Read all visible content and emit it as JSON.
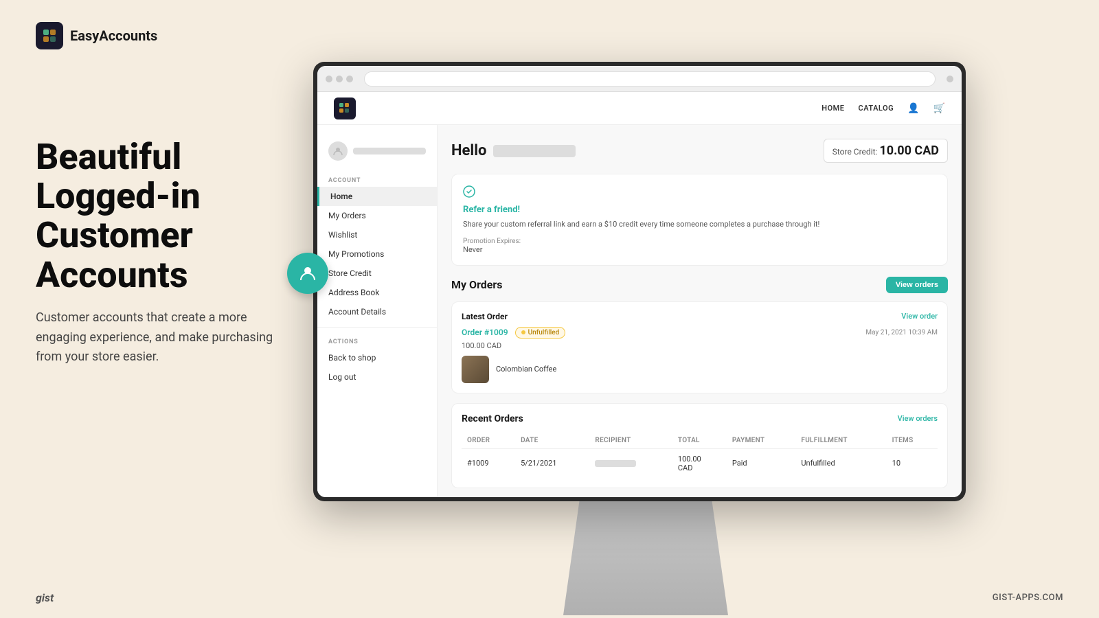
{
  "brand": {
    "name": "EasyAccounts",
    "logo_alt": "EasyAccounts logo"
  },
  "hero": {
    "title": "Beautiful Logged-in Customer Accounts",
    "subtitle": "Customer accounts that create a more engaging experience, and make purchasing from your store easier."
  },
  "store": {
    "nav": {
      "home": "HOME",
      "catalog": "CATALOG"
    },
    "sidebar": {
      "section_account": "ACCOUNT",
      "section_actions": "ACTIONS",
      "items": [
        {
          "label": "Home",
          "active": true
        },
        {
          "label": "My Orders",
          "active": false
        },
        {
          "label": "Wishlist",
          "active": false
        },
        {
          "label": "My Promotions",
          "active": false
        },
        {
          "label": "Store Credit",
          "active": false
        },
        {
          "label": "Address Book",
          "active": false
        },
        {
          "label": "Account Details",
          "active": false
        }
      ],
      "actions": [
        {
          "label": "Back to shop"
        },
        {
          "label": "Log out"
        }
      ]
    },
    "account_header": {
      "hello": "Hello",
      "store_credit_label": "Store Credit:",
      "store_credit_amount": "10.00 CAD"
    },
    "referral": {
      "title": "Refer a friend!",
      "description": "Share your custom referral link and earn a $10 credit every time someone completes a purchase through it!",
      "expires_label": "Promotion Expires:",
      "expires_value": "Never"
    },
    "my_orders": {
      "title": "My Orders",
      "view_btn": "View orders",
      "latest_order": {
        "label": "Latest Order",
        "view_link": "View order",
        "order_number": "Order #1009",
        "badge": "Unfulfilled",
        "date": "May 21, 2021 10:39 AM",
        "amount": "100.00 CAD",
        "product_name": "Colombian Coffee"
      },
      "recent_orders": {
        "title": "Recent Orders",
        "view_link": "View orders",
        "columns": [
          "ORDER",
          "DATE",
          "RECIPIENT",
          "TOTAL",
          "PAYMENT",
          "FULFILLMENT",
          "ITEMS"
        ],
        "rows": [
          {
            "order": "#1009",
            "date": "5/21/2021",
            "recipient": "",
            "total": "100.00 CAD",
            "payment": "Paid",
            "fulfillment": "Unfulfilled",
            "items": "10"
          }
        ]
      }
    }
  },
  "footer": {
    "brand": "gist",
    "link": "GIST-APPS.COM"
  }
}
